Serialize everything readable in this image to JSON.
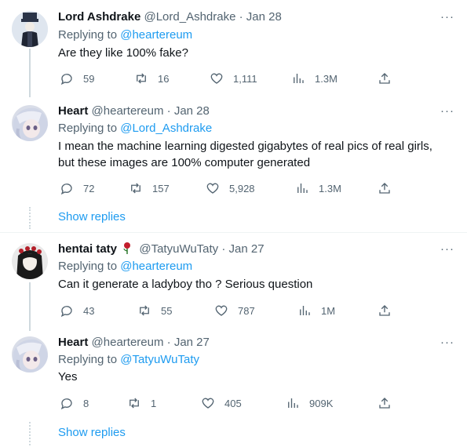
{
  "colors": {
    "accent": "#1d9bf0",
    "muted": "#536471",
    "text": "#0f1419"
  },
  "tweets": [
    {
      "name": "Lord Ashdrake",
      "handle": "@Lord_Ashdrake",
      "sep": "·",
      "date": "Jan 28",
      "replying_prefix": "Replying to ",
      "replying_to": "@heartereum",
      "text": "Are they like 100% fake?",
      "replies": "59",
      "retweets": "16",
      "likes": "1,111",
      "views": "1.3M"
    },
    {
      "name": "Heart",
      "handle": "@heartereum",
      "sep": "·",
      "date": "Jan 28",
      "replying_prefix": "Replying to ",
      "replying_to": "@Lord_Ashdrake",
      "text": "I mean the machine learning digested gigabytes of real pics of real girls, but these images are 100% computer generated",
      "replies": "72",
      "retweets": "157",
      "likes": "5,928",
      "views": "1.3M",
      "show_replies": "Show replies"
    },
    {
      "name": "hentai taty",
      "handle": "@TatyuWuTaty",
      "sep": "·",
      "date": "Jan 27",
      "replying_prefix": "Replying to ",
      "replying_to": "@heartereum",
      "text": "Can it generate a ladyboy tho ? Serious question",
      "replies": "43",
      "retweets": "55",
      "likes": "787",
      "views": "1M"
    },
    {
      "name": "Heart",
      "handle": "@heartereum",
      "sep": "·",
      "date": "Jan 27",
      "replying_prefix": "Replying to ",
      "replying_to": "@TatyuWuTaty",
      "text": "Yes",
      "replies": "8",
      "retweets": "1",
      "likes": "405",
      "views": "909K",
      "show_replies": "Show replies"
    }
  ],
  "icons": {
    "more": "more-icon",
    "reply": "reply-icon",
    "retweet": "retweet-icon",
    "like": "like-icon",
    "views": "views-icon",
    "share": "share-icon",
    "rose": "rose-icon"
  }
}
